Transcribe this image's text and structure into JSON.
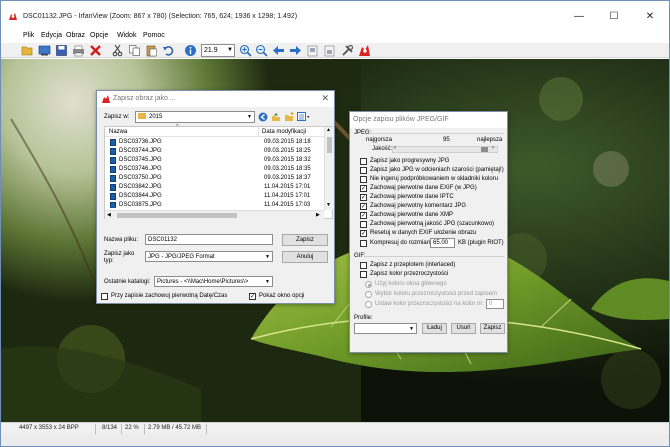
{
  "window": {
    "title": "DSC01132.JPG - IrfanView (Zoom: 867 x 780) (Selection: 765, 624; 1936 x 1298; 1.492)",
    "minimize": "—",
    "maximize": "☐",
    "close": "✕"
  },
  "menu": [
    "Plik",
    "Edycja",
    "Obraz",
    "Opcje",
    "Widok",
    "Pomoc"
  ],
  "toolbar": {
    "zoom_value": "21.9",
    "icons": [
      "open-folder-icon",
      "slideshow-icon",
      "save-icon",
      "print-icon",
      "delete-icon",
      "cut-icon",
      "copy-icon",
      "paste-icon",
      "undo-icon",
      "info-icon",
      "zoom-in-icon",
      "zoom-out-icon",
      "previous-icon",
      "next-icon",
      "first-page-icon",
      "last-page-icon",
      "settings-icon",
      "irfanview-logo-icon"
    ]
  },
  "status": {
    "dimensions": "4497 x 3553 x 24 BPP",
    "index": "8/134",
    "zoom": "22 %",
    "size": "2.79 MB / 45.72 MB"
  },
  "save_dialog": {
    "title": "Zapisz obraz jako ...",
    "save_in_label": "Zapisz w:",
    "folder": "2015",
    "col_name": "Nazwa",
    "col_date": "Data modyfikacji",
    "files": [
      {
        "name": "DSC03736.JPG",
        "date": "09.03.2015 18:18"
      },
      {
        "name": "DSC03744.JPG",
        "date": "09.03.2015 18:25"
      },
      {
        "name": "DSC03745.JPG",
        "date": "09.03.2015 18:32"
      },
      {
        "name": "DSC03746.JPG",
        "date": "09.03.2015 18:35"
      },
      {
        "name": "DSC03750.JPG",
        "date": "09.03.2015 18:37"
      },
      {
        "name": "DSC03842.JPG",
        "date": "11.04.2015 17:01"
      },
      {
        "name": "DSC03844.JPG",
        "date": "11.04.2015 17:01"
      },
      {
        "name": "DSC03875.JPG",
        "date": "11.04.2015 17:03"
      }
    ],
    "filename_label": "Nazwa pliku:",
    "filename": "DSC01132",
    "save_button": "Zapisz",
    "type_label_1": "Zapisz jako",
    "type_label_2": "typ:",
    "type_value": "JPG - JPG/JPEG Format",
    "cancel_button": "Anuluj",
    "recent_label": "Ostatnie katalogi:",
    "recent_value": "Pictures - <\\\\Mac\\Home\\Pictures\\>",
    "keep_date_label": "Przy zapisie zachowuj pierwotną Datę/Czas",
    "show_options_label": "Pokaż okno opcji"
  },
  "jpeg_dialog": {
    "title": "Opcje zapisu plików JPEG/GIF",
    "jpeg_group": "JPEG:",
    "worst_label": "najgorsza",
    "quality_value": "95",
    "best_label": "najlepsza",
    "quality_label": "Jakość:",
    "options": [
      {
        "label": "Zapisz jako progresywny JPG",
        "checked": false
      },
      {
        "label": "Zapisz jako JPG w odcieniach szarości (pamiętaj!)",
        "checked": false
      },
      {
        "label": "Nie ingeruj podpróbkowaniem w składniki koloru",
        "checked": false
      },
      {
        "label": "Zachowaj pierwotne dane EXIF (w JPG)",
        "checked": true
      },
      {
        "label": "Zachowaj pierwotne dane IPTC",
        "checked": true
      },
      {
        "label": "Zachowaj pierwotny komentarz JPG",
        "checked": true
      },
      {
        "label": "Zachowaj pierwotne dane XMP",
        "checked": true
      },
      {
        "label": "Zachowaj pierwotną jakość JPG  (szacunkowo)",
        "checked": false
      },
      {
        "label": "Resetuj w danych EXIF ułożenie obrazu",
        "checked": true
      }
    ],
    "compress_label": "Kompresuj do rozmiaru:",
    "compress_value": "65.00",
    "compress_unit": "KB (plugin RIOT)",
    "gif_group": "GIF:",
    "gif_interlaced": "Zapisz z przeplotem (interlaced)",
    "gif_transparent": "Zapisz kolor przezroczystości",
    "radio_1": "Użyj koloru okna głównego",
    "radio_2": "Wybór koloru przezroczystości przed zapisem",
    "radio_3": "Ustaw kolor przezroczystości na kolor nr:",
    "color_index": "0",
    "profile_label": "Profile:",
    "load_button": "Ładuj",
    "delete_button": "Usuń",
    "save_button": "Zapisz"
  }
}
